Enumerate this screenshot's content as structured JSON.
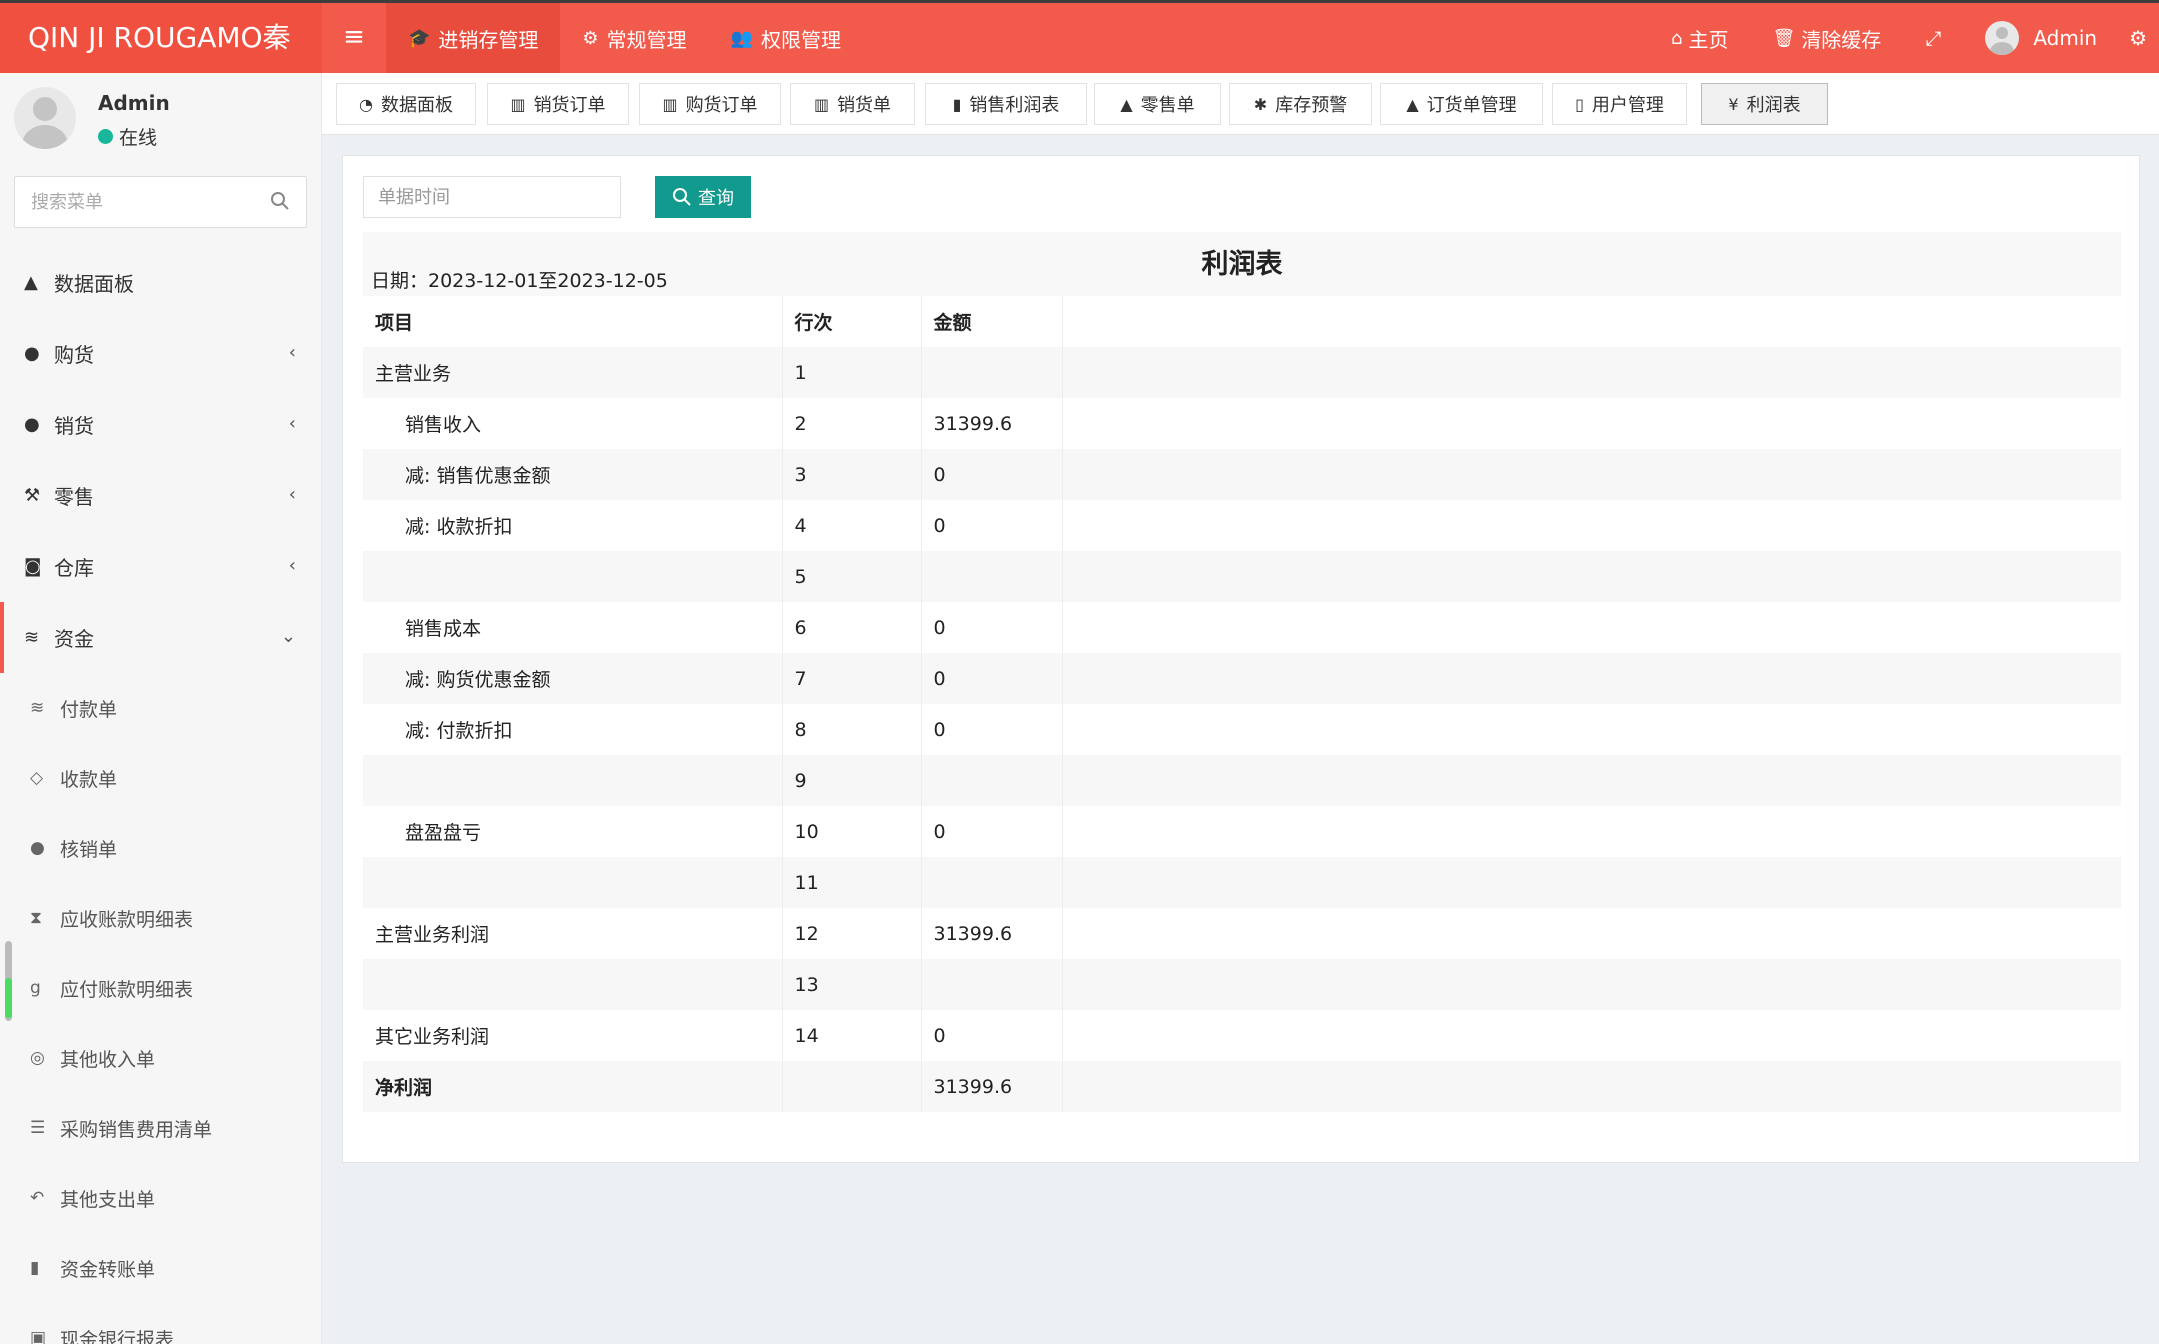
{
  "header": {
    "logo": "QIN JI ROUGAMO秦",
    "nav": [
      {
        "label": "进销存管理",
        "icon": "graduation-cap-icon"
      },
      {
        "label": "常规管理",
        "icon": "cogs-icon"
      },
      {
        "label": "权限管理",
        "icon": "users-icon"
      }
    ],
    "home_label": "主页",
    "clear_cache_label": "清除缓存",
    "user_name": "Admin"
  },
  "sidebar": {
    "user_name": "Admin",
    "status": "在线",
    "search_placeholder": "搜索菜单",
    "menu": [
      {
        "label": "数据面板",
        "icon": "area-chart-icon"
      },
      {
        "label": "购货",
        "icon": "github-icon"
      },
      {
        "label": "销货",
        "icon": "apple-icon"
      },
      {
        "label": "零售",
        "icon": "gavel-icon"
      },
      {
        "label": "仓库",
        "icon": "creative-commons-icon"
      },
      {
        "label": "资金",
        "icon": "database-icon"
      }
    ],
    "submenu": [
      {
        "label": "付款单",
        "icon": "database-icon"
      },
      {
        "label": "收款单",
        "icon": "diamond-icon"
      },
      {
        "label": "核销单",
        "icon": "apple-icon"
      },
      {
        "label": "应收账款明细表",
        "icon": "hourglass-icon"
      },
      {
        "label": "应付账款明细表",
        "icon": "google-plus-icon"
      },
      {
        "label": "其他收入单",
        "icon": "chrome-icon"
      },
      {
        "label": "采购销售费用清单",
        "icon": "list-alt-icon"
      },
      {
        "label": "其他支出单",
        "icon": "reply-icon"
      },
      {
        "label": "资金转账单",
        "icon": "book-icon"
      },
      {
        "label": "现金银行报表",
        "icon": "bitbucket-icon"
      }
    ]
  },
  "tabs": [
    {
      "label": "数据面板",
      "icon": "dashboard-icon"
    },
    {
      "label": "销货订单",
      "icon": "bar-chart-icon"
    },
    {
      "label": "购货订单",
      "icon": "bar-chart-icon"
    },
    {
      "label": "销货单",
      "icon": "bar-chart-icon"
    },
    {
      "label": "销售利润表",
      "icon": "bookmark-icon"
    },
    {
      "label": "零售单",
      "icon": "area-chart-icon"
    },
    {
      "label": "库存预警",
      "icon": "bug-icon"
    },
    {
      "label": "订货单管理",
      "icon": "area-chart-icon"
    },
    {
      "label": "用户管理",
      "icon": "id-badge-icon"
    },
    {
      "label": "利润表",
      "icon": "yen-icon"
    }
  ],
  "filter": {
    "date_placeholder": "单据时间",
    "query_label": "查询"
  },
  "report": {
    "title": "利润表",
    "date_label": "日期：2023-12-01至2023-12-05",
    "columns": [
      "项目",
      "行次",
      "金额"
    ],
    "rows": [
      {
        "item": "主营业务",
        "line": "1",
        "amount": ""
      },
      {
        "item": "销售收入",
        "line": "2",
        "amount": "31399.6"
      },
      {
        "item": "减: 销售优惠金额",
        "line": "3",
        "amount": "0"
      },
      {
        "item": "减: 收款折扣",
        "line": "4",
        "amount": "0"
      },
      {
        "item": "",
        "line": "5",
        "amount": ""
      },
      {
        "item": "销售成本",
        "line": "6",
        "amount": "0"
      },
      {
        "item": "减: 购货优惠金额",
        "line": "7",
        "amount": "0"
      },
      {
        "item": "减: 付款折扣",
        "line": "8",
        "amount": "0"
      },
      {
        "item": "",
        "line": "9",
        "amount": ""
      },
      {
        "item": "盘盈盘亏",
        "line": "10",
        "amount": "0"
      },
      {
        "item": "",
        "line": "11",
        "amount": ""
      },
      {
        "item": "主营业务利润",
        "line": "12",
        "amount": "31399.6"
      },
      {
        "item": "",
        "line": "13",
        "amount": ""
      },
      {
        "item": "其它业务利润",
        "line": "14",
        "amount": "0"
      },
      {
        "item": "净利润",
        "line": "",
        "amount": "31399.6"
      }
    ]
  },
  "colors": {
    "header_bg": "#f25a4b",
    "logo_bg": "#f0503f",
    "accent_teal": "#139a8e",
    "status_online": "#18b69b"
  }
}
